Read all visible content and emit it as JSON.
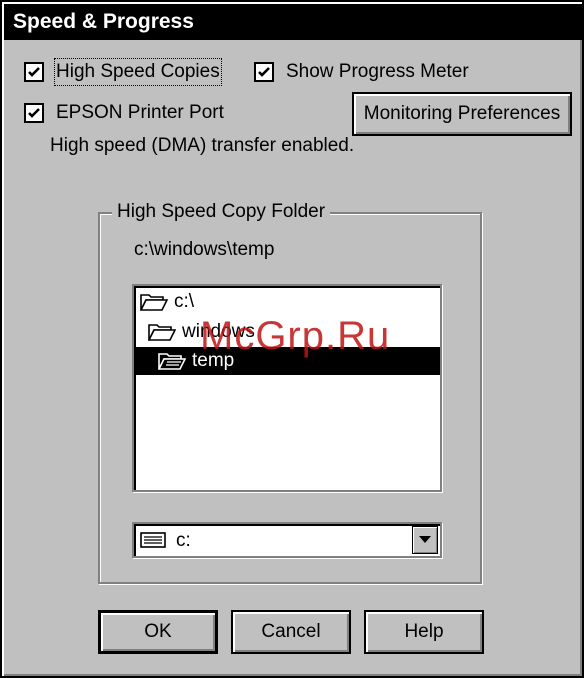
{
  "dialog": {
    "title": "Speed & Progress"
  },
  "options": {
    "high_speed_copies": {
      "label": "High Speed Copies",
      "checked": true
    },
    "show_progress_meter": {
      "label": "Show Progress Meter",
      "checked": true
    },
    "epson_printer_port": {
      "label": "EPSON Printer Port",
      "checked": true
    },
    "dma_status": "High speed (DMA) transfer enabled."
  },
  "buttons": {
    "monitoring_preferences": "Monitoring Preferences",
    "ok": "OK",
    "cancel": "Cancel",
    "help": "Help"
  },
  "copy_folder": {
    "group_title": "High Speed Copy Folder",
    "current_path": "c:\\windows\\temp",
    "tree": [
      {
        "label": "c:\\",
        "icon": "folder-open-icon",
        "level": 0,
        "selected": false
      },
      {
        "label": "windows",
        "icon": "folder-open-icon",
        "level": 1,
        "selected": false
      },
      {
        "label": "temp",
        "icon": "folder-open-icon",
        "level": 2,
        "selected": true
      }
    ],
    "drive": {
      "value": "c:",
      "icon": "hard-drive-icon"
    }
  },
  "watermark": "McGrp.Ru",
  "colors": {
    "window_background": "#c0c0c0",
    "title_bar": "#000000",
    "title_text": "#ffffff",
    "selection": "#000000",
    "watermark": "#be1414"
  }
}
